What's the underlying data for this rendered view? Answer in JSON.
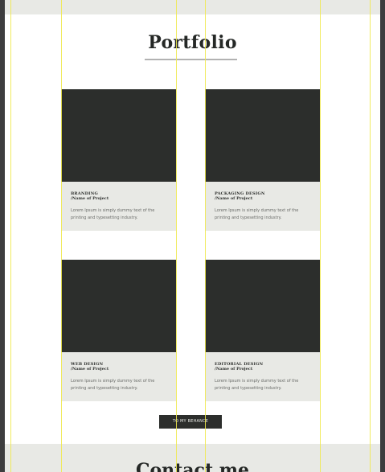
{
  "portfolio": {
    "title": "Portfolio",
    "projects": [
      {
        "category": "BRANDING",
        "name": "/Name of Project",
        "description": "Lorem Ipsum is simply dummy text of the printing and typesetting industry."
      },
      {
        "category": "PACKAGING DESIGN",
        "name": "/Name of Project",
        "description": "Lorem Ipsum is simply dummy text of the printing and typesetting industry."
      },
      {
        "category": "WEB DESIGN",
        "name": "/Name of Project",
        "description": "Lorem Ipsum is simply dummy text of the printing and typesetting industry."
      },
      {
        "category": "EDITORIAL DESIGN",
        "name": "/Name of Project",
        "description": "Lorem Ipsum is simply dummy text of the printing and typesetting industry."
      }
    ],
    "behance_button": "TO MY BEHANCE"
  },
  "contact": {
    "title": "Contact me"
  },
  "colors": {
    "dark": "#2c2e2c",
    "light_gray": "#e8e9e5",
    "guide": "#f0e94e",
    "canvas": "#3d3d3f"
  }
}
